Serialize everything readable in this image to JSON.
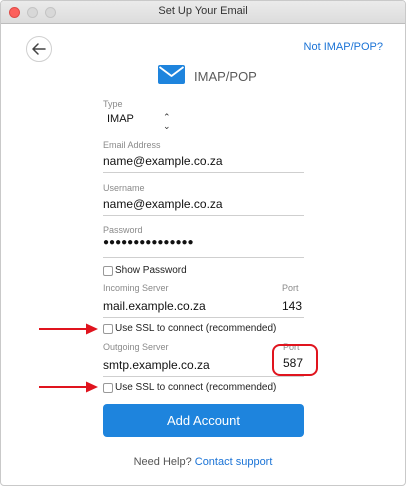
{
  "window": {
    "title": "Set Up Your Email"
  },
  "header": {
    "not_imap_link": "Not IMAP/POP?",
    "heading": "IMAP/POP"
  },
  "form": {
    "type": {
      "label": "Type",
      "value": "IMAP"
    },
    "email": {
      "label": "Email Address",
      "value": "name@example.co.za"
    },
    "username": {
      "label": "Username",
      "value": "name@example.co.za"
    },
    "password": {
      "label": "Password",
      "value": "●●●●●●●●●●●●●●●"
    },
    "show_password": "Show Password",
    "incoming": {
      "label": "Incoming Server",
      "value": "mail.example.co.za",
      "port_label": "Port",
      "port": "143",
      "ssl": "Use SSL to connect (recommended)"
    },
    "outgoing": {
      "label": "Outgoing Server",
      "value": "smtp.example.co.za",
      "port_label": "Port",
      "port": "587",
      "ssl": "Use SSL to connect (recommended)"
    }
  },
  "actions": {
    "add_account": "Add Account"
  },
  "footer": {
    "help_text": "Need Help?",
    "contact_link": "Contact support"
  },
  "colors": {
    "accent": "#1e84dd",
    "annotation": "#e0141e"
  },
  "icons": {
    "back": "arrow-left-icon",
    "logo": "mail-envelope-icon",
    "dropdown": "chevron-updown-icon",
    "annotation": "red-arrow-icon"
  }
}
